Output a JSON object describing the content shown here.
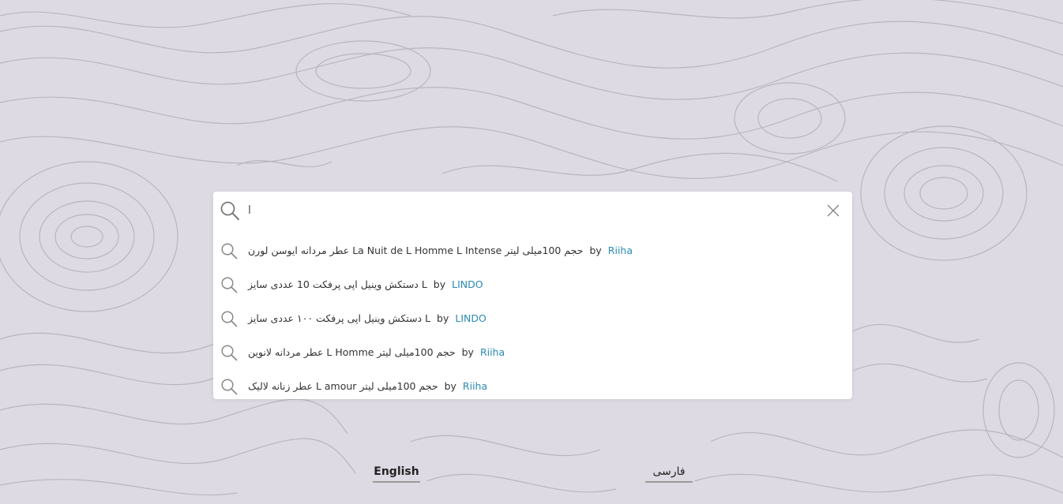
{
  "search": {
    "value": "l",
    "placeholder": ""
  },
  "suggestions": [
    {
      "title": "عطر مردانه ایوسن لورن La Nuit de L Homme L Intense حجم 100میلی لیتر",
      "by": "by",
      "brand": "Riiha"
    },
    {
      "title": "دستکش وینیل اپی پرفکت 10 عددی سایز L",
      "by": "by",
      "brand": "LINDO"
    },
    {
      "title": "دستکش وینیل اپی پرفکت ۱۰۰ عددی سایز L",
      "by": "by",
      "brand": "LINDO"
    },
    {
      "title": "عطر مردانه لانوین L Homme حجم 100میلی لیتر",
      "by": "by",
      "brand": "Riiha"
    },
    {
      "title": "عطر زنانه لالیک L amour حجم 100میلی لیتر",
      "by": "by",
      "brand": "Riiha"
    }
  ],
  "languages": {
    "english": "English",
    "persian": "فارسی"
  },
  "icons": {
    "search": "search-icon",
    "close": "close-icon"
  },
  "colors": {
    "background": "#dedae3",
    "contour": "#b3afb8",
    "brand_link": "#2a8bb3"
  }
}
